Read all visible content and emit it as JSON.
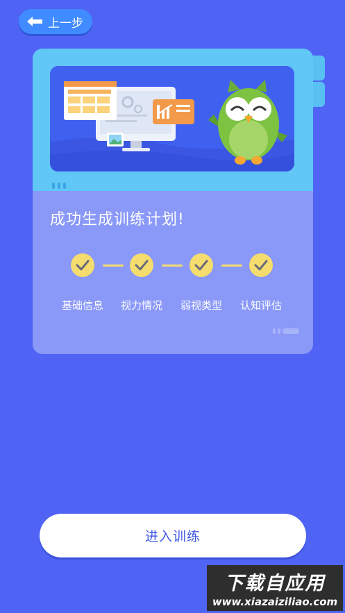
{
  "header": {
    "back_label": "上一步"
  },
  "card": {
    "title": "成功生成训练计划!",
    "steps": [
      {
        "label": "基础信息",
        "done": true
      },
      {
        "label": "视力情况",
        "done": true
      },
      {
        "label": "弱视类型",
        "done": true
      },
      {
        "label": "认知评估",
        "done": true
      }
    ]
  },
  "footer": {
    "enter_label": "进入训练"
  },
  "watermark": {
    "brand": "下载自应用",
    "url": "www.xiazaiziliao.com"
  },
  "colors": {
    "background": "#4f63f4",
    "card": "#8a98f7",
    "frame": "#61c7f6",
    "check": "#f4dd6e",
    "owl_green": "#7ec242"
  }
}
